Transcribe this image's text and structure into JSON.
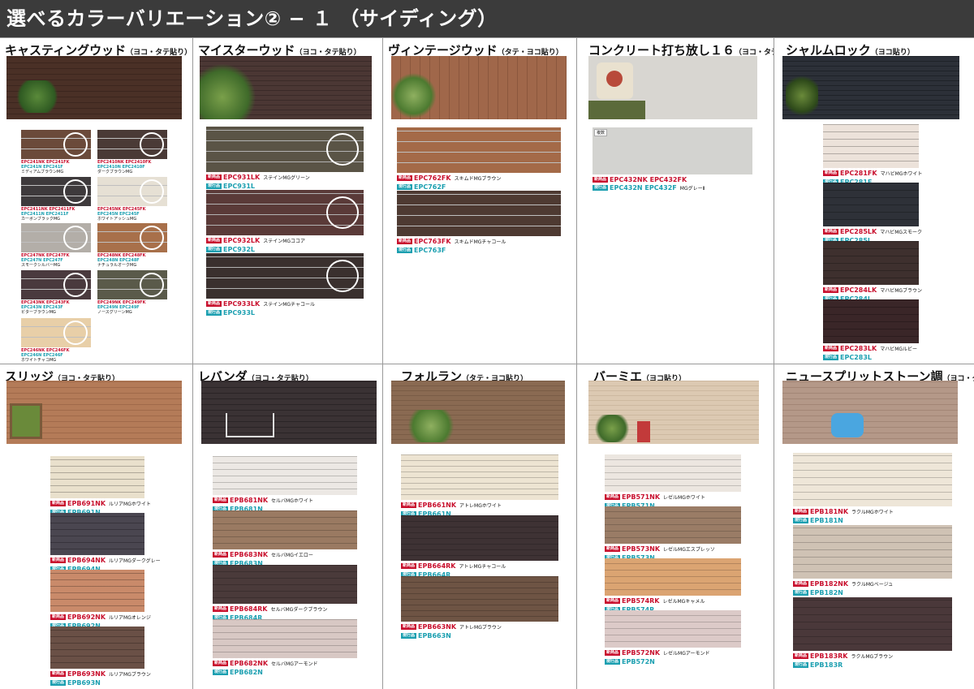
{
  "header": {
    "title": "選べるカラーバリエーション② − １ （サイディング）"
  },
  "labels": {
    "new": "新商品",
    "old": "現行品",
    "multi": "複数"
  },
  "panels": {
    "castying": {
      "title": "キャスティングウッド",
      "sub": "（ヨコ・タテ貼り）",
      "items": [
        {
          "nk": "EPC241NK",
          "fk": "EPC241FK",
          "n": "EPC241N",
          "f": "EPC241F",
          "name": "ミディアムブラウンMG"
        },
        {
          "nk": "EPC2410NK",
          "fk": "EPC2410FK",
          "n": "EPC2410N",
          "f": "EPC2410F",
          "name": "ダークブラウンMG"
        },
        {
          "nk": "EPC2411NK",
          "fk": "EPC2411FK",
          "n": "EPC2411N",
          "f": "EPC2411F",
          "name": "カーボンブラックMG"
        },
        {
          "nk": "EPC245NK",
          "fk": "EPC245FK",
          "n": "EPC245N",
          "f": "EPC245F",
          "name": "ホワイトアッシュMG"
        },
        {
          "nk": "EPC247NK",
          "fk": "EPC247FK",
          "n": "EPC247N",
          "f": "EPC247F",
          "name": "スモークシルバーMG"
        },
        {
          "nk": "EPC248NK",
          "fk": "EPC248FK",
          "n": "EPC248N",
          "f": "EPC248F",
          "name": "ナチュラルオークMG"
        },
        {
          "nk": "EPC243NK",
          "fk": "EPC243FK",
          "n": "EPC243N",
          "f": "EPC243F",
          "name": "ビターブラウンMG"
        },
        {
          "nk": "EPC249NK",
          "fk": "EPC249FK",
          "n": "EPC249N",
          "f": "EPC249F",
          "name": "ノースグリーンMG"
        },
        {
          "nk": "EPC246NK",
          "fk": "EPC246FK",
          "n": "EPC246N",
          "f": "EPC246F",
          "name": "ホワイトチャコMG"
        }
      ]
    },
    "meister": {
      "title": "マイスターウッド",
      "sub": "（ヨコ・タテ貼り）",
      "items": [
        {
          "nk": "EPC931LK",
          "n": "EPC931L",
          "name": "ステインMGグリーン"
        },
        {
          "nk": "EPC932LK",
          "n": "EPC932L",
          "name": "ステインMGココア"
        },
        {
          "nk": "EPC933LK",
          "n": "EPC933L",
          "name": "ステインMGチャコール"
        }
      ]
    },
    "vintage": {
      "title": "ヴィンテージウッド",
      "sub": "（タテ・ヨコ貼り）",
      "items": [
        {
          "nk": "EPC762FK",
          "n": "EPC762F",
          "name": "スキムドMGブラウン"
        },
        {
          "nk": "EPC763FK",
          "n": "EPC763F",
          "name": "スキムドMGチャコール"
        }
      ]
    },
    "concrete": {
      "title": "コンクリート打ち放し１６",
      "sub": "（ヨコ・タテ貼り）",
      "items": [
        {
          "nk": "EPC432NK",
          "fk": "EPC432FK",
          "n": "EPC432N",
          "f": "EPC432F",
          "name": "MGグレーⅡ"
        }
      ]
    },
    "sharum": {
      "title": "シャルムロック",
      "sub": "（ヨコ貼り）",
      "items": [
        {
          "nk": "EPC281FK",
          "n": "EPC281F",
          "name": "マハビMGホワイト"
        },
        {
          "nk": "EPC285LK",
          "n": "EPC285L",
          "name": "マハビMGスモーク"
        },
        {
          "nk": "EPC284LK",
          "n": "EPC284L",
          "name": "マハビMGブラウン"
        },
        {
          "nk": "EPC283LK",
          "n": "EPC283L",
          "name": "マハビMGルビー"
        }
      ]
    },
    "slidge": {
      "title": "スリッジ",
      "sub": "（ヨコ・タテ貼り）",
      "items": [
        {
          "nk": "EPB691NK",
          "n": "EPB691N",
          "name": "ルリアMGホワイト"
        },
        {
          "nk": "EPB694NK",
          "n": "EPB694N",
          "name": "ルリアMGダークグレー"
        },
        {
          "nk": "EPB692NK",
          "n": "EPB692N",
          "name": "ルリアMGオレンジ"
        },
        {
          "nk": "EPB693NK",
          "n": "EPB693N",
          "name": "ルリアMGブラウン"
        }
      ]
    },
    "levanda": {
      "title": "レバンダ",
      "sub": "（ヨコ・タテ貼り）",
      "items": [
        {
          "nk": "EPB681NK",
          "n": "EPB681N",
          "name": "セルバMGホワイト"
        },
        {
          "nk": "EPB683NK",
          "n": "EPB683N",
          "name": "セルバMGイエロー"
        },
        {
          "nk": "EPB684RK",
          "n": "EPB684R",
          "name": "セルバMGダークブラウン"
        },
        {
          "nk": "EPB682NK",
          "n": "EPB682N",
          "name": "セルバMGアーモンド"
        }
      ]
    },
    "forlan": {
      "title": "フォルラン",
      "sub": "（タテ・ヨコ貼り）",
      "items": [
        {
          "nk": "EPB661NK",
          "n": "EPB661N",
          "name": "アトレMGホワイト"
        },
        {
          "nk": "EPB664RK",
          "n": "EPB664R",
          "name": "アトレMGチャコール"
        },
        {
          "nk": "EPB663NK",
          "n": "EPB663N",
          "name": "アトレMGブラウン"
        }
      ]
    },
    "barmie": {
      "title": "バーミエ",
      "sub": "（ヨコ貼り）",
      "items": [
        {
          "nk": "EPB571NK",
          "n": "EPB571N",
          "name": "レゼルMGホワイト"
        },
        {
          "nk": "EPB573NK",
          "n": "EPB573N",
          "name": "レゼルMGエスプレッソ"
        },
        {
          "nk": "EPB574RK",
          "n": "EPB574R",
          "name": "レゼルMGキャメル"
        },
        {
          "nk": "EPB572NK",
          "n": "EPB572N",
          "name": "レゼルMGアーモンド"
        }
      ]
    },
    "newsplit": {
      "title": "ニュースプリットストーン調",
      "sub": "（ヨコ・タテ貼り）",
      "items": [
        {
          "nk": "EPB181NK",
          "n": "EPB181N",
          "name": "ラクルMGホワイト"
        },
        {
          "nk": "EPB182NK",
          "n": "EPB182N",
          "name": "ラクルMGベージュ"
        },
        {
          "nk": "EPB183RK",
          "n": "EPB183R",
          "name": "ラクルMGブラウン"
        }
      ]
    }
  },
  "colors": {
    "header_bg": "#3b3b3b",
    "new_red": "#c8102e",
    "old_teal": "#1b9fb0"
  }
}
